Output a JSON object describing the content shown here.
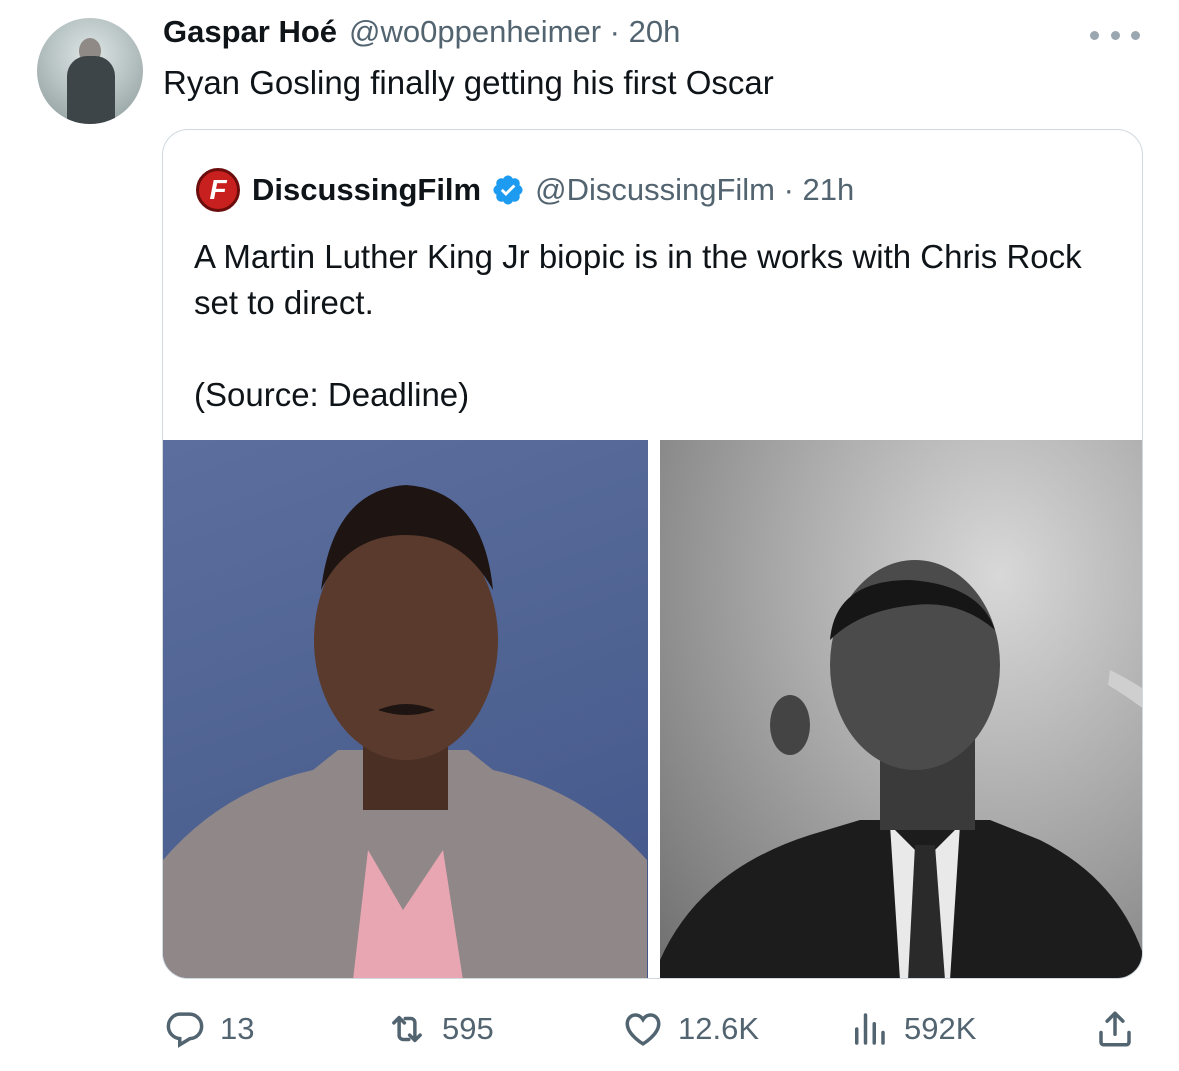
{
  "tweet": {
    "author_name": "Gaspar Hoé",
    "meta": "@wo0ppenheimer · 20h",
    "text": "Ryan Gosling finally getting his first Oscar"
  },
  "quoted_tweet": {
    "logo_text": "F",
    "author_name": "DiscussingFilm",
    "meta": "@DiscussingFilm · 21h",
    "text_line1": "A Martin Luther King Jr biopic is in the works with Chris Rock set to direct.",
    "text_line2": "(Source: Deadline)"
  },
  "actions": {
    "replies": "13",
    "reposts": "595",
    "likes": "12.6K",
    "views": "592K"
  },
  "colors": {
    "text": "#0f1419",
    "secondary": "#536471",
    "verified": "#1d9bf0",
    "border": "#cfd9de",
    "logo_red": "#c8201e"
  },
  "icons": [
    "avatar",
    "more-icon",
    "discussingfilm-logo",
    "verified-icon",
    "reply-icon",
    "repost-icon",
    "like-icon",
    "views-icon",
    "share-icon"
  ]
}
